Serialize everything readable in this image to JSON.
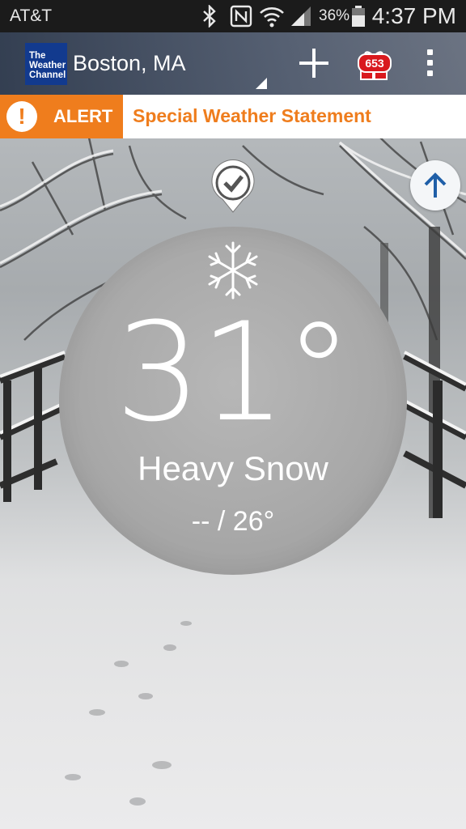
{
  "status_bar": {
    "carrier": "AT&T",
    "battery_percent": "36%",
    "time": "4:37 PM",
    "icons": [
      "bluetooth-icon",
      "nfc-icon",
      "wifi-icon",
      "signal-icon",
      "battery-icon"
    ]
  },
  "app_bar": {
    "logo_text": "The Weather Channel",
    "location": "Boston, MA",
    "add_icon": "plus-icon",
    "gift_badge": "653",
    "menu_icon": "overflow-menu-icon"
  },
  "alert": {
    "label": "ALERT",
    "text": "Special Weather Statement",
    "accent_color": "#ef7d1d"
  },
  "current": {
    "condition_icon": "snowflake-icon",
    "temperature": "31°",
    "condition": "Heavy Snow",
    "hi_lo": "-- / 26°"
  },
  "controls": {
    "pin_icon": "check-location-pin-icon",
    "scroll_up_icon": "arrow-up-icon"
  }
}
